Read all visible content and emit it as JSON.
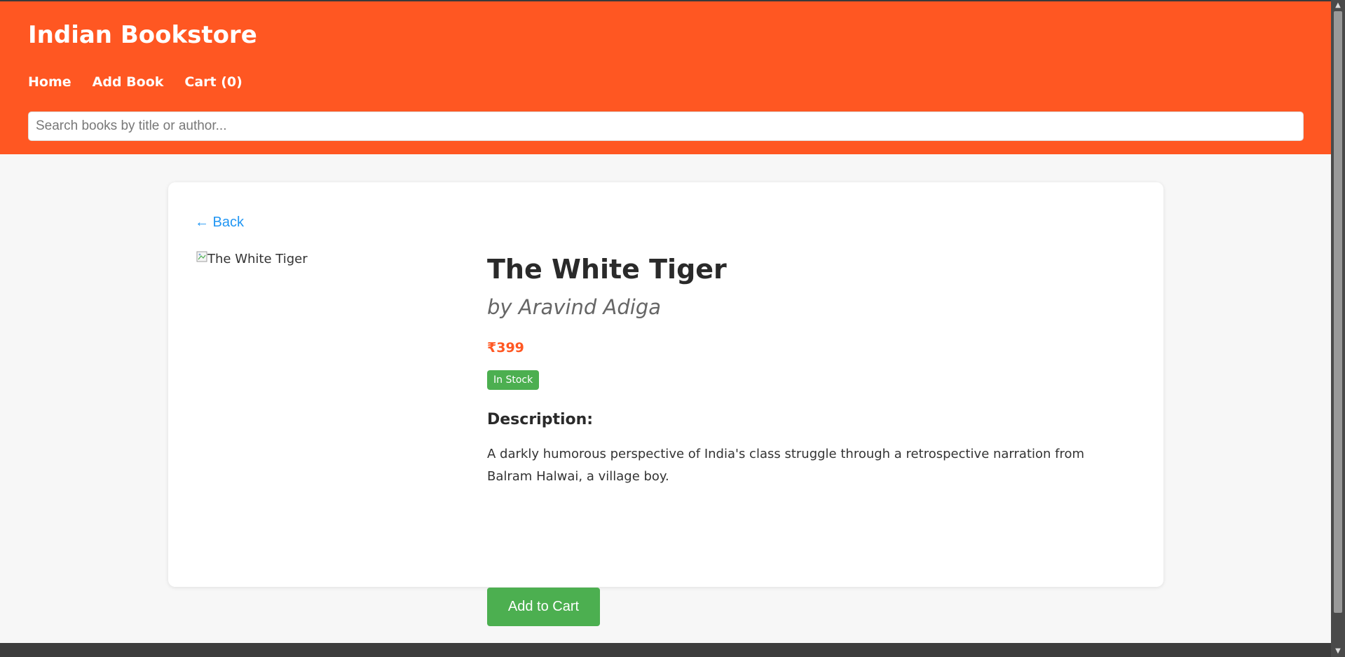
{
  "header": {
    "site_title": "Indian Bookstore",
    "nav": {
      "home": "Home",
      "add_book": "Add Book",
      "cart": "Cart (0)"
    },
    "search_placeholder": "Search books by title or author..."
  },
  "book": {
    "back_label": "← Back",
    "cover_alt": "The White Tiger",
    "title": "The White Tiger",
    "author": "by Aravind Adiga",
    "price": "₹399",
    "stock_status": "In Stock",
    "description_heading": "Description:",
    "description": "A darkly humorous perspective of India's class struggle through a retrospective narration from Balram Halwai, a village boy.",
    "add_to_cart_label": "Add to Cart"
  },
  "colors": {
    "brand": "#ff5722",
    "success": "#4caf50",
    "link": "#2196f3"
  },
  "icons": {
    "cover": "broken-image-icon",
    "scroll_up": "scroll-up-arrow-icon",
    "scroll_down": "scroll-down-arrow-icon"
  }
}
